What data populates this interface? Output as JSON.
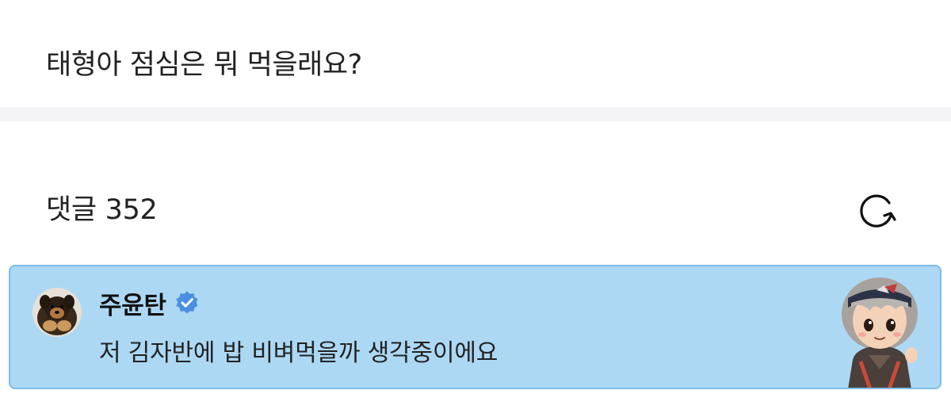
{
  "post": {
    "text": "태형아 점심은 뭐 먹을래요?"
  },
  "comments": {
    "count_label": "댓글 352",
    "refresh_icon": "refresh-icon"
  },
  "comment": {
    "author": "주윤탄",
    "verified_icon": "verified-badge-icon",
    "text": "저 김자반에 밥 비벼먹을까 생각중이에요",
    "background_color": "#acd8f4",
    "border_color": "#7fbce8",
    "badge_color": "#4a8fe0"
  }
}
